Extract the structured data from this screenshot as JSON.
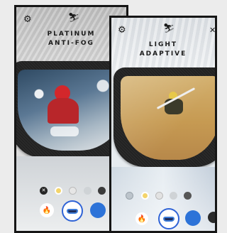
{
  "left_screen": {
    "title_line1": "PLATINUM",
    "title_line2": "ANTI-FOG",
    "icons": {
      "settings": "gear-icon",
      "mode": "skier-icon"
    }
  },
  "right_screen": {
    "title_line1": "LIGHT",
    "title_line2": "ADAPTIVE",
    "icons": {
      "settings": "gear-icon",
      "mode": "skier-icon",
      "close": "close-icon"
    }
  },
  "icon_glyphs": {
    "gear": "⚙",
    "skier": "⛷",
    "close": "✕",
    "fire": "🔥",
    "x": "✕"
  },
  "colors": {
    "accent_blue": "#2d73d8",
    "frame": "#161616",
    "orange": "#e4552b"
  }
}
